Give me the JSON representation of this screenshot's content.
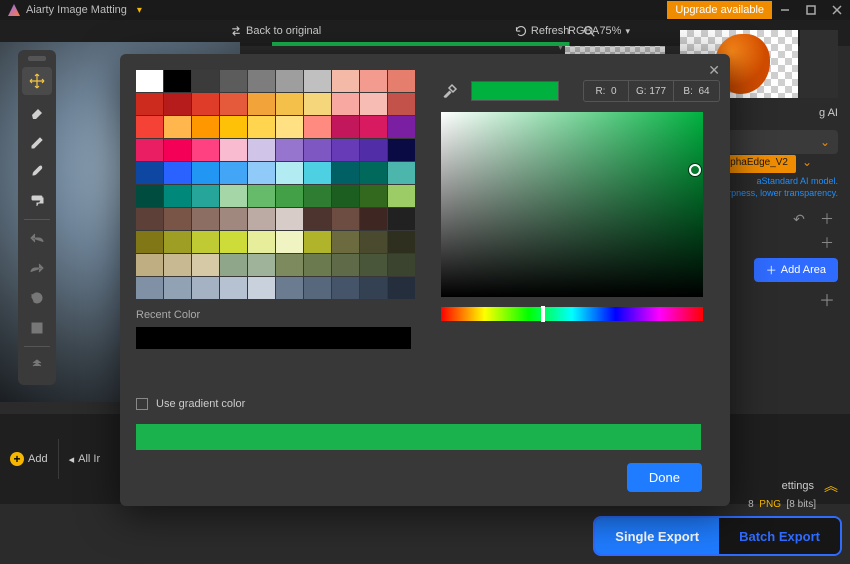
{
  "titlebar": {
    "app_name": "Aiarty Image Matting",
    "upgrade": "Upgrade available"
  },
  "topbar": {
    "back": "Back to original",
    "refresh": "Refresh",
    "zoom": "75%",
    "colormode": "RGBA"
  },
  "right_panel": {
    "ai_label": "g AI",
    "alpha_edge": "lphaEdge_V2",
    "desc_line1": "aStandard AI model.",
    "desc_line2": "rpness, lower transparency.",
    "add_area": "Add Area"
  },
  "filmstrip": {
    "add": "Add",
    "all": "All Ir"
  },
  "settings": {
    "title": "ettings",
    "line2_num": "8",
    "line2_fmt": "PNG",
    "line2_bits": "[8 bits]"
  },
  "export": {
    "single": "Single Export",
    "batch": "Batch Export"
  },
  "picker": {
    "recent_label": "Recent Color",
    "use_gradient": "Use gradient color",
    "done": "Done",
    "rgb": {
      "r_label": "R:",
      "r": "0",
      "g_label": "G:",
      "g": "177",
      "b_label": "B:",
      "b": "64"
    },
    "current_color": "#00b140",
    "swatches": [
      "#ffffff",
      "#000000",
      "#3b3b3b",
      "#5c5c5c",
      "#7d7d7d",
      "#9e9e9e",
      "#c0c0c0",
      "#f5b9a8",
      "#f29b8e",
      "#e67e6e",
      "#cc2b1d",
      "#b71c1c",
      "#e03c2a",
      "#e55a3a",
      "#f2a33a",
      "#f4c04a",
      "#f6d67a",
      "#f8a8a0",
      "#f7bdb5",
      "#c2524a",
      "#f44336",
      "#ffb74d",
      "#ff9800",
      "#ffc107",
      "#ffd54f",
      "#ffe082",
      "#ff8a80",
      "#c2185b",
      "#d81b60",
      "#7b1fa2",
      "#e91e63",
      "#f50057",
      "#ff4081",
      "#f8bbd0",
      "#d1c4e9",
      "#9575cd",
      "#7e57c2",
      "#673ab7",
      "#512da8",
      "#0a0a44",
      "#0d47a1",
      "#2962ff",
      "#2196f3",
      "#42a5f5",
      "#90caf9",
      "#b2ebf2",
      "#4dd0e1",
      "#006064",
      "#00695c",
      "#4db6ac",
      "#004d40",
      "#00897b",
      "#26a69a",
      "#a5d6a7",
      "#66bb6a",
      "#43a047",
      "#2e7d32",
      "#1b5e20",
      "#33691e",
      "#9ccc65",
      "#5d4037",
      "#795548",
      "#8d6e63",
      "#a1887f",
      "#bcaaa4",
      "#d7ccc8",
      "#4e342e",
      "#6d4c41",
      "#3e2723",
      "#212121",
      "#827717",
      "#9e9d24",
      "#c0ca33",
      "#cddc39",
      "#e6ee9c",
      "#f0f4c3",
      "#afb42b",
      "#6b6b3f",
      "#4a4a2f",
      "#2f2f1f",
      "#bfae82",
      "#c9b993",
      "#d6caa6",
      "#8fa68b",
      "#9fb39b",
      "#7c8a5e",
      "#6c7a50",
      "#5e6a48",
      "#4a563a",
      "#3a442e",
      "#8091a5",
      "#92a2b5",
      "#a4b2c4",
      "#b6c2d1",
      "#c8d1dc",
      "#6c7c90",
      "#57687d",
      "#455468",
      "#344152",
      "#242e3c"
    ]
  }
}
